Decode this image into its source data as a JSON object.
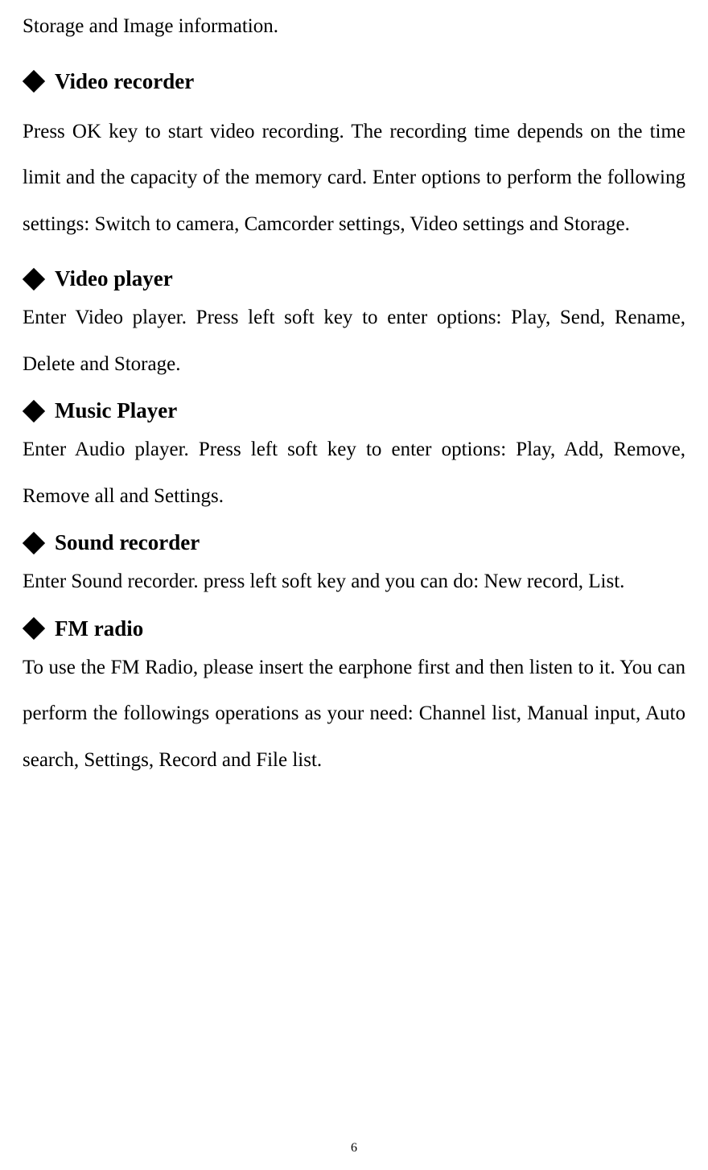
{
  "intro_text": "Storage and Image information.",
  "sections": [
    {
      "heading": "Video recorder",
      "body": "Press OK key to start video recording. The recording time depends on the time limit and the capacity of the memory card. Enter options to perform the following settings: Switch to camera, Camcorder settings, Video settings and Storage."
    },
    {
      "heading": "Video player",
      "body": "Enter Video player. Press left soft key to enter options: Play, Send, Rename, Delete and Storage."
    },
    {
      "heading": "Music Player",
      "body": "Enter Audio player. Press left soft key to enter options: Play, Add, Remove, Remove all and Settings."
    },
    {
      "heading": "Sound recorder",
      "body": "Enter Sound recorder. press left soft key and you can do: New record, List."
    },
    {
      "heading": "FM radio",
      "body": "To use the FM Radio, please insert the earphone first and then listen to it. You can perform the followings operations as your need: Channel list, Manual input, Auto search, Settings, Record and File list."
    }
  ],
  "page_number": "6"
}
